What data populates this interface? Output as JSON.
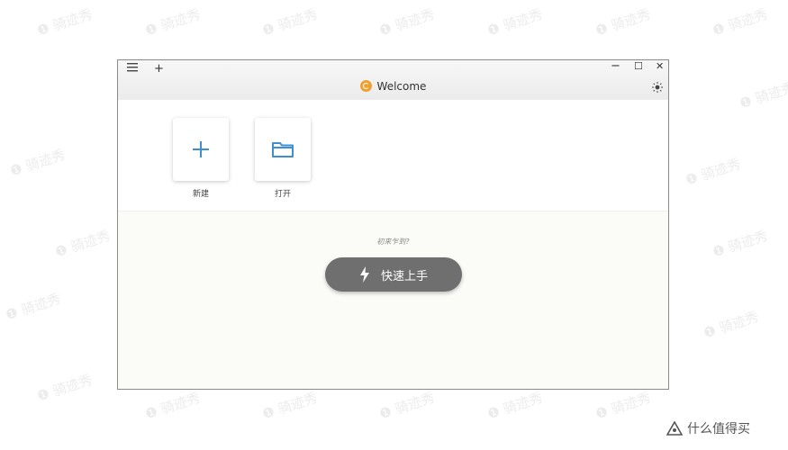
{
  "window": {
    "menu_icon": "hamburger-menu-icon",
    "new_tab_label": "+",
    "title": "Welcome",
    "minimize_label": "−",
    "maximize_label": "☐",
    "close_label": "✕",
    "theme_icon": "sun-icon"
  },
  "tiles": [
    {
      "label": "新建",
      "icon": "plus-icon"
    },
    {
      "label": "打开",
      "icon": "folder-icon"
    }
  ],
  "prompt_text": "初来乍到?",
  "quick_start_label": "快速上手",
  "watermark_text": "❶ 骑迹秀",
  "brand_text": "什么值得买",
  "colors": {
    "accent_blue": "#3d8fd0",
    "button_gray": "#6f6f6f",
    "logo_orange": "#f0a030"
  }
}
